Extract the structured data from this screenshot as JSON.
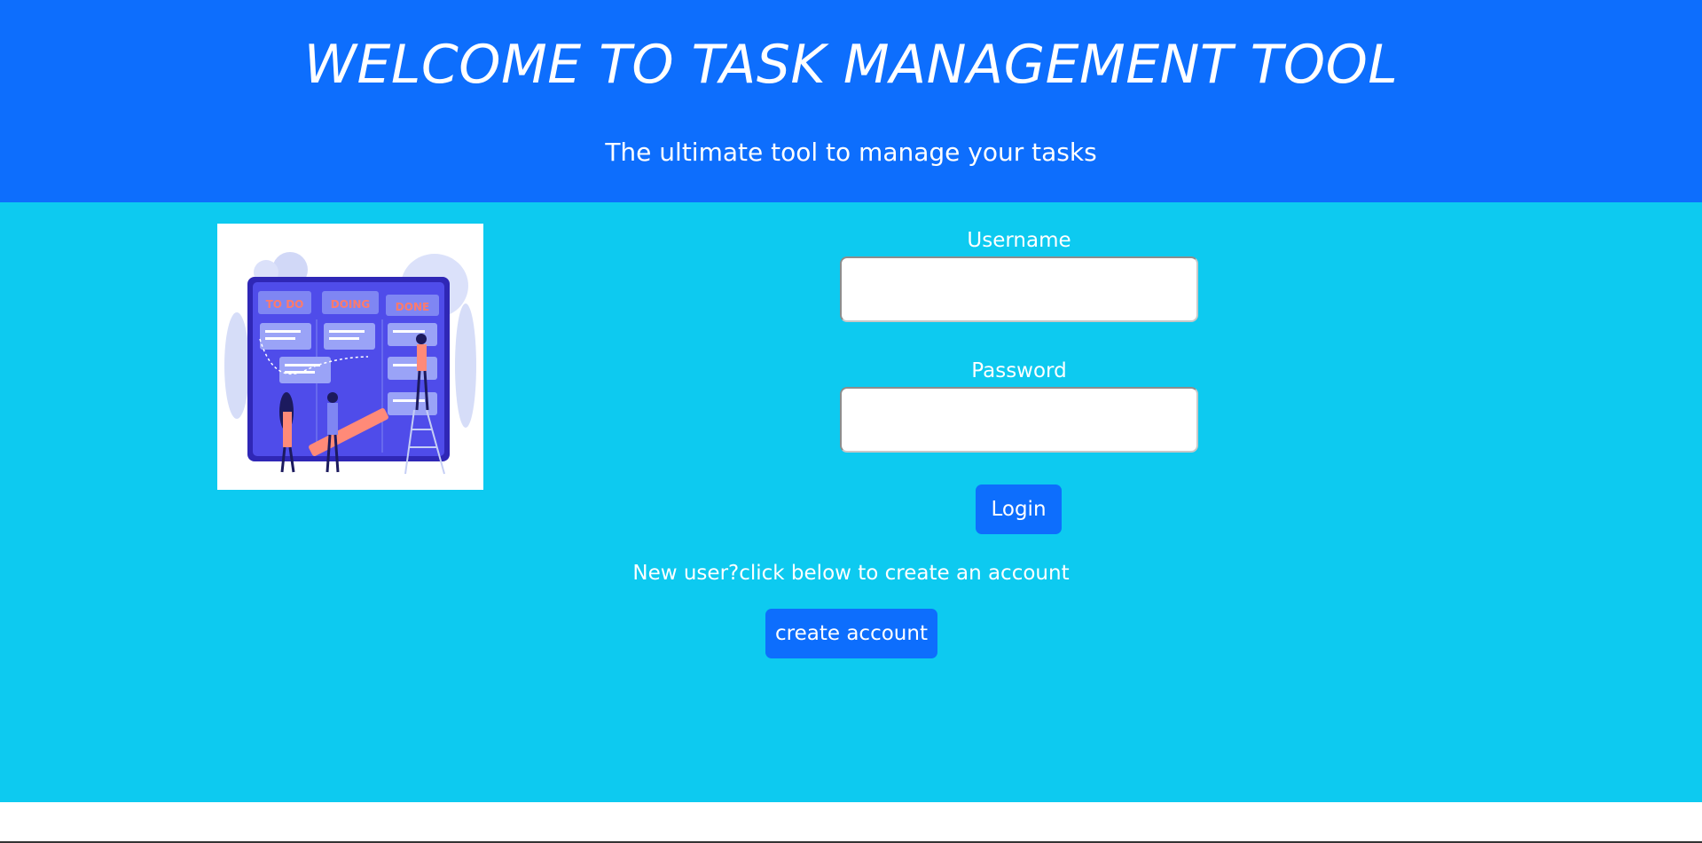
{
  "header": {
    "title": "WELCOME TO TASK MANAGEMENT TOOL",
    "subtitle": "The ultimate tool to manage your tasks"
  },
  "illustration": {
    "columns": [
      "TO DO",
      "DOING",
      "DONE"
    ]
  },
  "login_form": {
    "username_label": "Username",
    "username_value": "",
    "password_label": "Password",
    "password_value": "",
    "login_button": "Login"
  },
  "signup": {
    "prompt": "New user?click below to create an account",
    "button": "create account"
  },
  "colors": {
    "header_bg": "#0d6efd",
    "main_bg": "#0dcaf0",
    "button_bg": "#0d6efd",
    "text": "#ffffff"
  }
}
